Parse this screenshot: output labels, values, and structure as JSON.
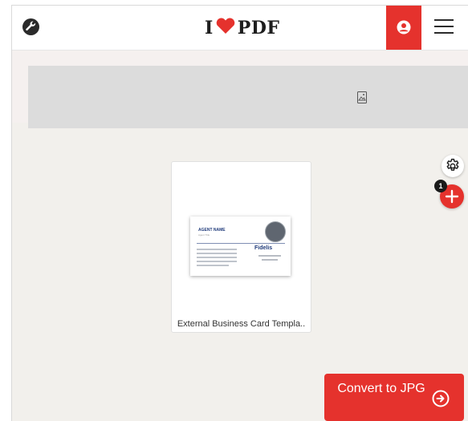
{
  "header": {
    "tools_icon": "wrench-icon",
    "logo": {
      "prefix": "I",
      "suffix": "PDF",
      "heart_icon": "heart-icon"
    },
    "account_icon": "user-icon",
    "menu_icon": "hamburger-menu-icon",
    "brand_color": "#e5322d"
  },
  "ad_banner": {
    "icon": "image-icon"
  },
  "files": [
    {
      "name": "External Business Card Templa..",
      "thumbnail": {
        "agent_name": "AGENT NAME",
        "agent_title": "Agent Title",
        "brand": "Fidelis"
      }
    }
  ],
  "side_actions": {
    "settings_icon": "gear-icon",
    "add_icon": "plus-icon",
    "file_count": "1"
  },
  "convert_button": {
    "label": "Convert to JPG",
    "icon": "arrow-right-circle-icon"
  }
}
